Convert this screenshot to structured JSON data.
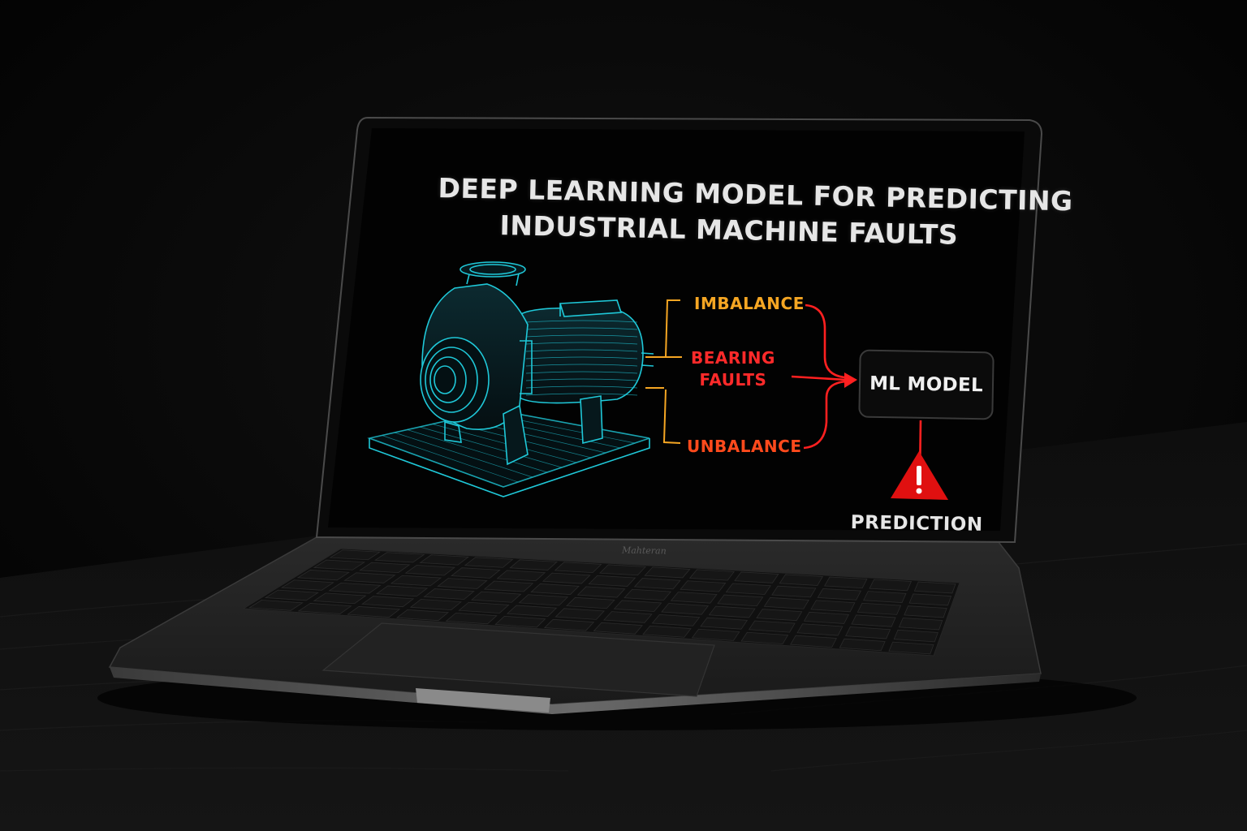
{
  "screen": {
    "title_line1": "DEEP LEARNING MODEL FOR PREDICTING",
    "title_line2": "INDUSTRIAL MACHINE FAULTS"
  },
  "faults": [
    {
      "text": "IMBALANCE",
      "color": "#f5a623"
    },
    {
      "text": "BEARING\nFAULTS",
      "color": "#ff2a2a"
    },
    {
      "text": "UNBALANCE",
      "color": "#ff4a1c"
    }
  ],
  "model": {
    "label": "ML MODEL"
  },
  "output": {
    "label": "PREDICTION",
    "icon": "warning-icon"
  },
  "laptop": {
    "brand": "Mahteran"
  },
  "colors": {
    "wireframe": "#1fc8d8",
    "bracket": "#f5a623",
    "arrow": "#ff2020",
    "warning": "#e01010"
  }
}
